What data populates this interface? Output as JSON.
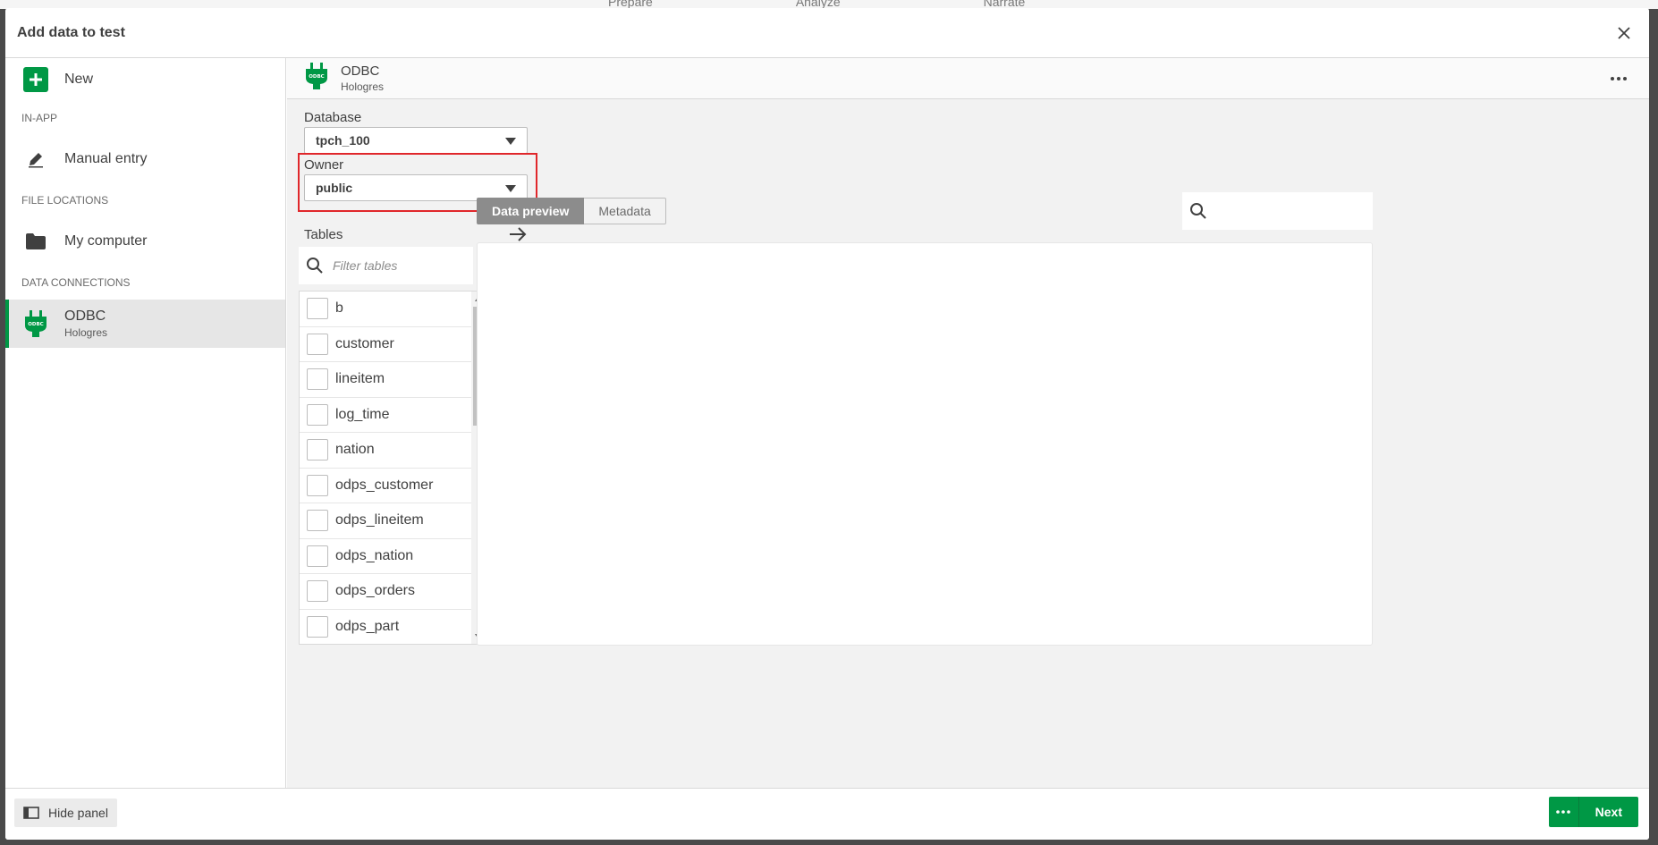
{
  "background_tabs": [
    "Prepare",
    "Analyze",
    "Narrate"
  ],
  "dialog": {
    "title": "Add data to test"
  },
  "sidebar": {
    "new_label": "New",
    "section_in_app": "IN-APP",
    "manual_entry": "Manual entry",
    "section_file_locations": "FILE LOCATIONS",
    "my_computer": "My computer",
    "section_data_connections": "DATA CONNECTIONS",
    "connection": {
      "name": "ODBC",
      "sub": "Hologres"
    }
  },
  "main": {
    "connection": {
      "name": "ODBC",
      "sub": "Hologres"
    },
    "database": {
      "label": "Database",
      "value": "tpch_100"
    },
    "owner": {
      "label": "Owner",
      "value": "public"
    },
    "tables": {
      "label": "Tables",
      "filter_placeholder": "Filter tables",
      "items": [
        "b",
        "customer",
        "lineitem",
        "log_time",
        "nation",
        "odps_customer",
        "odps_lineitem",
        "odps_nation",
        "odps_orders",
        "odps_part"
      ]
    },
    "tabs": {
      "data_preview": "Data preview",
      "metadata": "Metadata"
    }
  },
  "footer": {
    "hide_panel": "Hide panel",
    "next": "Next"
  },
  "colors": {
    "accent_green": "#009845",
    "highlight_red": "#e0272b"
  }
}
